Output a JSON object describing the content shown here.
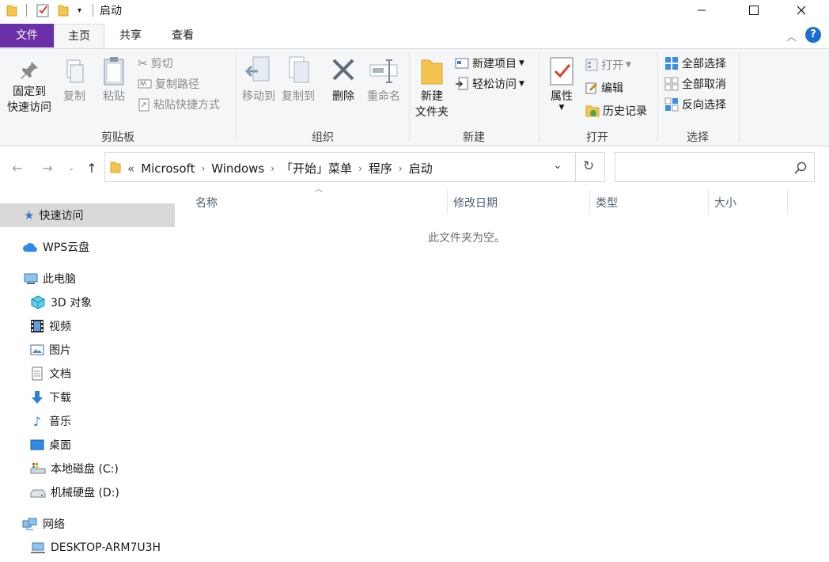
{
  "window": {
    "title": "启动"
  },
  "ribbon_tabs": {
    "file": "文件",
    "home": "主页",
    "share": "共享",
    "view": "查看"
  },
  "clipboard": {
    "pin": [
      "固定到",
      "快速访问"
    ],
    "copy": "复制",
    "paste": "粘贴",
    "cut": "剪切",
    "copy_path": "复制路径",
    "paste_shortcut": "粘贴快捷方式",
    "label": "剪贴板"
  },
  "organize": {
    "move_to": "移动到",
    "copy_to": "复制到",
    "delete": "删除",
    "rename": "重命名",
    "label": "组织"
  },
  "new_group": {
    "new_folder": [
      "新建",
      "文件夹"
    ],
    "new_item": "新建项目",
    "easy_access": "轻松访问",
    "label": "新建"
  },
  "open_group": {
    "properties": "属性",
    "open": "打开",
    "edit": "编辑",
    "history": "历史记录",
    "label": "打开"
  },
  "select_group": {
    "select_all": "全部选择",
    "select_none": "全部取消",
    "invert": "反向选择",
    "label": "选择"
  },
  "address": {
    "overflow": "«",
    "crumbs": [
      "Microsoft",
      "Windows",
      "「开始」菜单",
      "程序",
      "启动"
    ]
  },
  "nav": {
    "quick_access": "快速访问",
    "wps": "WPS云盘",
    "this_pc": "此电脑",
    "items": [
      "3D 对象",
      "视频",
      "图片",
      "文档",
      "下载",
      "音乐",
      "桌面",
      "本地磁盘 (C:)",
      "机械硬盘 (D:)"
    ],
    "network": "网络",
    "desktop": "DESKTOP-ARM7U3H"
  },
  "columns": {
    "name": "名称",
    "modified": "修改日期",
    "type": "类型",
    "size": "大小"
  },
  "empty_message": "此文件夹为空。",
  "colors": {
    "file_tab": "#6b2fa8",
    "ribbon_bg": "#f5f6f7",
    "selected": "#d9d9d9"
  }
}
